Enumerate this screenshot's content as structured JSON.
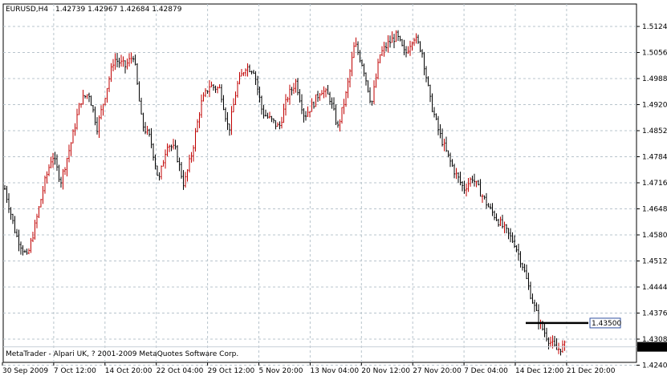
{
  "header": {
    "symbol": "EURUSD,H4",
    "ohlc": "1.42739 1.42967 1.42684 1.42879"
  },
  "footer": {
    "copyright": "MetaTrader - Alpari UK, ? 2001-2009 MetaQuotes Software Corp."
  },
  "chart_data": {
    "type": "ohlc",
    "title": "EURUSD,H4",
    "y_ticks": [
      "1.51240",
      "1.50560",
      "1.49880",
      "1.49200",
      "1.48520",
      "1.47840",
      "1.47160",
      "1.46480",
      "1.45800",
      "1.45120",
      "1.44440",
      "1.43760",
      "1.43080",
      "1.42400"
    ],
    "x_ticks": [
      "30 Sep 2009",
      "7 Oct 12:00",
      "14 Oct 20:00",
      "22 Oct 04:00",
      "29 Oct 12:00",
      "5 Nov 20:00",
      "13 Nov 04:00",
      "20 Nov 12:00",
      "27 Nov 20:00",
      "7 Dec 04:00",
      "14 Dec 12:00",
      "21 Dec 20:00"
    ],
    "ylim": [
      1.424,
      1.5154
    ],
    "grid": true,
    "current_price": "1.42879",
    "line_label": "1.43500",
    "line_value": 1.435,
    "colors": {
      "up": "#c00000",
      "down": "#000000",
      "grid": "#b8c4cc",
      "axis": "#000000"
    },
    "path": [
      [
        0,
        1.47
      ],
      [
        4,
        1.458
      ],
      [
        8,
        1.452
      ],
      [
        11,
        1.461
      ],
      [
        14,
        1.471
      ],
      [
        17,
        1.479
      ],
      [
        20,
        1.472
      ],
      [
        24,
        1.483
      ],
      [
        27,
        1.493
      ],
      [
        30,
        1.495
      ],
      [
        33,
        1.486
      ],
      [
        36,
        1.495
      ],
      [
        39,
        1.504
      ],
      [
        43,
        1.502
      ],
      [
        46,
        1.505
      ],
      [
        49,
        1.487
      ],
      [
        52,
        1.483
      ],
      [
        55,
        1.472
      ],
      [
        58,
        1.482
      ],
      [
        61,
        1.48
      ],
      [
        64,
        1.471
      ],
      [
        67,
        1.48
      ],
      [
        70,
        1.492
      ],
      [
        73,
        1.497
      ],
      [
        77,
        1.496
      ],
      [
        80,
        1.485
      ],
      [
        83,
        1.497
      ],
      [
        86,
        1.502
      ],
      [
        89,
        1.501
      ],
      [
        92,
        1.49
      ],
      [
        95,
        1.488
      ],
      [
        98,
        1.486
      ],
      [
        101,
        1.494
      ],
      [
        104,
        1.498
      ],
      [
        107,
        1.489
      ],
      [
        110,
        1.492
      ],
      [
        113,
        1.496
      ],
      [
        116,
        1.494
      ],
      [
        119,
        1.486
      ],
      [
        122,
        1.495
      ],
      [
        125,
        1.508
      ],
      [
        128,
        1.502
      ],
      [
        131,
        1.492
      ],
      [
        134,
        1.505
      ],
      [
        137,
        1.508
      ],
      [
        140,
        1.51
      ],
      [
        143,
        1.505
      ],
      [
        146,
        1.51
      ],
      [
        149,
        1.506
      ],
      [
        152,
        1.493
      ],
      [
        155,
        1.485
      ],
      [
        158,
        1.479
      ],
      [
        161,
        1.474
      ],
      [
        164,
        1.47
      ],
      [
        167,
        1.473
      ],
      [
        170,
        1.469
      ],
      [
        173,
        1.465
      ],
      [
        176,
        1.462
      ],
      [
        179,
        1.459
      ],
      [
        182,
        1.456
      ],
      [
        185,
        1.45
      ],
      [
        188,
        1.442
      ],
      [
        191,
        1.435
      ],
      [
        194,
        1.431
      ],
      [
        197,
        1.428
      ],
      [
        200,
        1.429
      ]
    ]
  }
}
